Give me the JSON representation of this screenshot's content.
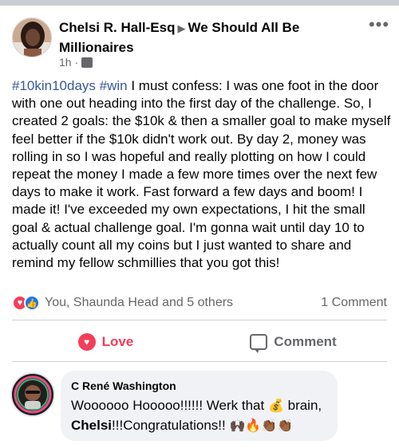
{
  "post": {
    "author": "Chelsi R. Hall-Esq",
    "group": "We Should All Be Millionaires",
    "time": "1h",
    "more_icon": "more-dots-icon",
    "hashtags": [
      "#10kin10days",
      "#win"
    ],
    "text": " I must confess: I was one foot in the door with one out heading into the first day of the challenge. So, I created 2 goals: the $10k & then a smaller goal to make myself feel better if the $10k didn't work out. By day 2, money was rolling in so I was hopeful and really plotting on how I could repeat the money I made a few more times over the next few days to make it work. Fast forward a few days and boom! I made it! I've exceeded my own expectations, I hit the small goal & actual challenge goal. I'm gonna wait until day 10 to actually count all my coins but I just wanted to share and remind my fellow schmillies that you got this!"
  },
  "reactions": {
    "summary": "You, Shaunda Head and 5 others",
    "comments": "1 Comment"
  },
  "actions": {
    "love": "Love",
    "comment": "Comment"
  },
  "comment": {
    "author": "C René Washington",
    "text_part1": "Woooooo Hooooo!!!!!! Werk that ",
    "emoji_moneybag": "💰",
    "text_part2": " brain,",
    "bold_name": "Chelsi",
    "text_part3": "!!!Congratulations!! ",
    "emoji_tail": "🙌🏿🔥👏🏾👏🏾"
  },
  "colors": {
    "link": "#385898",
    "love": "#f33e58",
    "like": "#1877f2",
    "secondary": "#65676b"
  }
}
